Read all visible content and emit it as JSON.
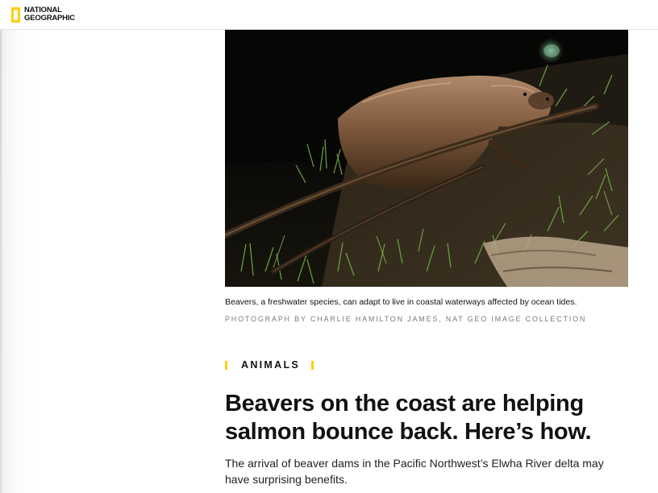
{
  "brand": {
    "logo_line1": "NATIONAL",
    "logo_line2": "GEOGRAPHIC",
    "accent_color": "#ffce00"
  },
  "photo": {
    "subject": "beaver",
    "caption": "Beavers, a freshwater species, can adapt to live in coastal waterways affected by ocean tides.",
    "credit": "PHOTOGRAPH BY CHARLIE HAMILTON JAMES, NAT GEO IMAGE COLLECTION"
  },
  "article": {
    "section": "ANIMALS",
    "headline": "Beavers on the coast are helping salmon bounce back. Here’s how.",
    "dek": "The arrival of beaver dams in the Pacific Northwest’s Elwha River delta may have surprising benefits."
  }
}
